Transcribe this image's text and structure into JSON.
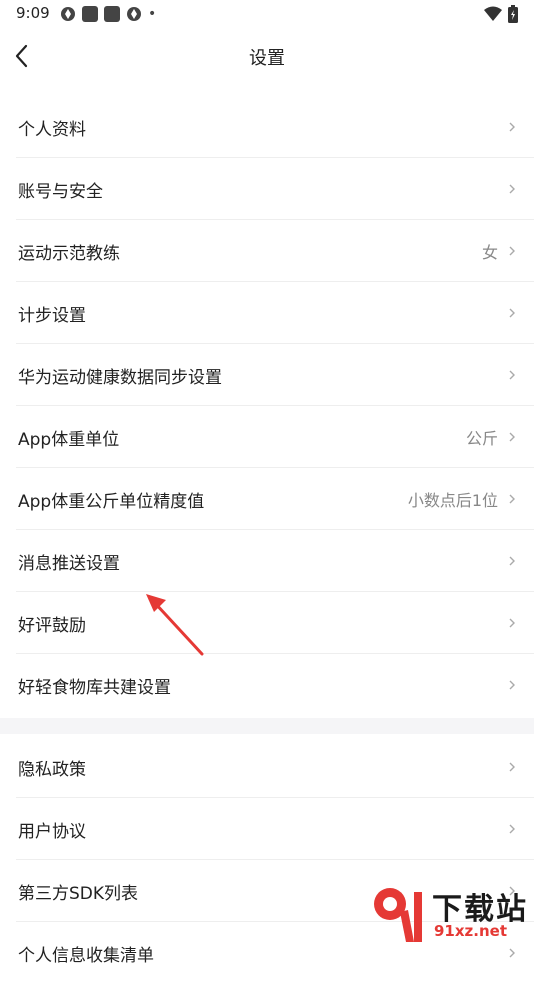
{
  "status": {
    "time": "9:09",
    "dot": "•"
  },
  "header": {
    "title": "设置"
  },
  "group1": [
    {
      "label": "个人资料",
      "value": ""
    },
    {
      "label": "账号与安全",
      "value": ""
    },
    {
      "label": "运动示范教练",
      "value": "女"
    },
    {
      "label": "计步设置",
      "value": ""
    },
    {
      "label": "华为运动健康数据同步设置",
      "value": ""
    },
    {
      "label": "App体重单位",
      "value": "公斤"
    },
    {
      "label": "App体重公斤单位精度值",
      "value": "小数点后1位"
    },
    {
      "label": "消息推送设置",
      "value": ""
    },
    {
      "label": "好评鼓励",
      "value": ""
    },
    {
      "label": "好轻食物库共建设置",
      "value": ""
    }
  ],
  "group2": [
    {
      "label": "隐私政策",
      "value": ""
    },
    {
      "label": "用户协议",
      "value": ""
    },
    {
      "label": "第三方SDK列表",
      "value": ""
    },
    {
      "label": "个人信息收集清单",
      "value": ""
    }
  ],
  "watermark": {
    "text": "下载站",
    "url": "91xz.net"
  },
  "colors": {
    "accent_arrow": "#e53935",
    "divider": "#eeeeee",
    "gap": "#f5f5f7"
  }
}
